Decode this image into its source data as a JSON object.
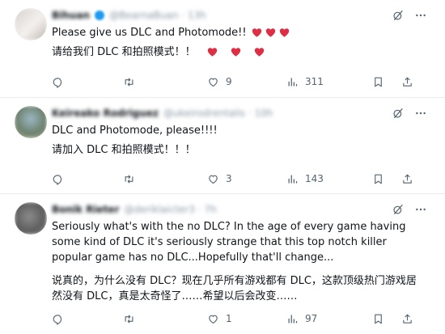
{
  "posts": [
    {
      "display_name": "Bihuan",
      "handle": "@BearnaBuan · 13h",
      "line1": "Please give us DLC and Photomode!!",
      "line2": "请给我们 DLC 和拍照模式！！",
      "replies": "",
      "reposts": "",
      "likes": "9",
      "views": "311"
    },
    {
      "display_name": "Keireako Rodriguez",
      "handle": "@ukeirodrentalis · 10h",
      "line1": "DLC and Photomode, please!!!!",
      "line2": "请加入 DLC 和拍照模式！！！",
      "replies": "",
      "reposts": "",
      "likes": "3",
      "views": "143"
    },
    {
      "display_name": "Bonik Rieter",
      "handle": "@deriklaicter3 · 7h",
      "en_text": "Seriously what's with the no DLC?  In the age of every game having some kind of DLC it's seriously strange that this top notch killer popular game has no DLC...Hopefully that'll change...",
      "zh_text": "说真的，为什么没有 DLC？现在几乎所有游戏都有 DLC，这款顶级热门游戏居然没有 DLC，真是太奇怪了……希望以后会改变……",
      "replies": "",
      "reposts": "",
      "likes": "1",
      "views": "97"
    }
  ],
  "colors": {
    "heart": "#f91880",
    "icon": "#536471",
    "divider": "#e6ecf0",
    "verified": "#1d9bf0"
  },
  "icons": [
    "grok-icon",
    "more-icon",
    "reply-icon",
    "repost-icon",
    "like-icon",
    "views-icon",
    "bookmark-icon",
    "share-icon",
    "heart-emoji"
  ]
}
